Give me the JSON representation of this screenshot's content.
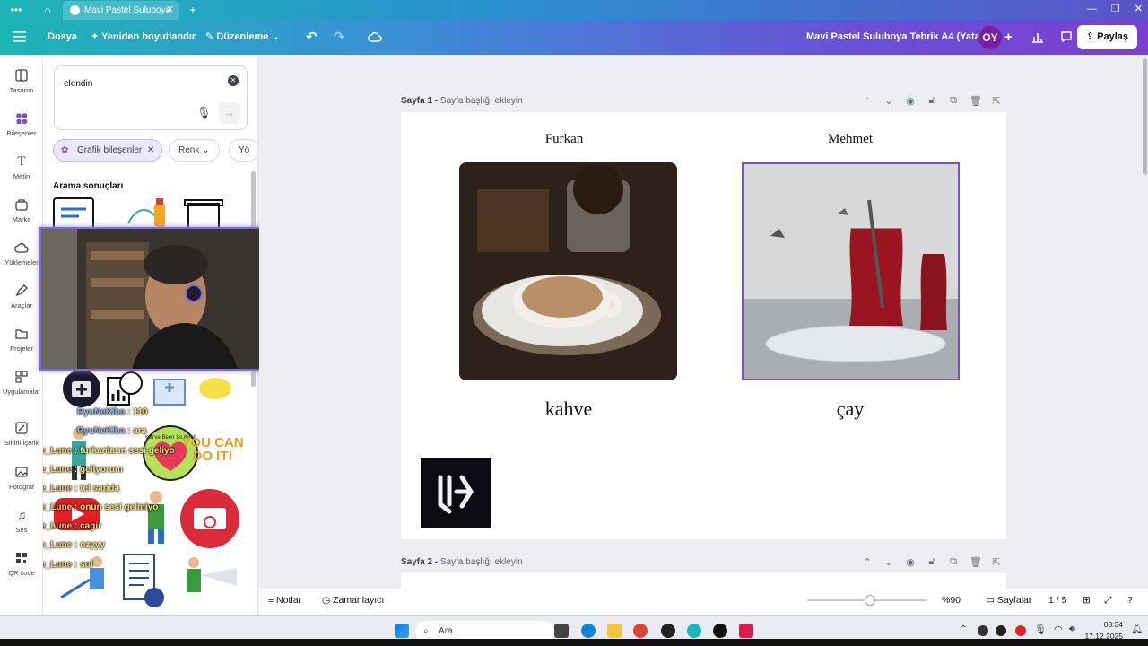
{
  "browser": {
    "tab_title": "Mavi Pastel Suluboya",
    "new_tab_symbol": "+"
  },
  "header": {
    "file": "Dosya",
    "resize": "Yeniden boyutlandır",
    "edit": "Düzenleme",
    "doc_title": "Mavi Pastel Suluboya Tebrik A4 (Yatay)",
    "avatar": "OY",
    "share": "Paylaş"
  },
  "rail": {
    "items": [
      {
        "label": "Tasarım",
        "icon": "layout-icon"
      },
      {
        "label": "Bileşenler",
        "icon": "elements-icon"
      },
      {
        "label": "Metin",
        "icon": "text-icon"
      },
      {
        "label": "Marka",
        "icon": "brand-icon"
      },
      {
        "label": "Yüklemeler",
        "icon": "upload-icon"
      },
      {
        "label": "Araçlar",
        "icon": "draw-icon"
      },
      {
        "label": "Projeler",
        "icon": "folder-icon"
      },
      {
        "label": "Uygulamalar",
        "icon": "apps-icon"
      },
      {
        "label": "Sihirli İçerik",
        "icon": "magic-icon"
      },
      {
        "label": "Fotoğraf",
        "icon": "photo-icon"
      },
      {
        "label": "Ses",
        "icon": "music-icon"
      },
      {
        "label": "QR code",
        "icon": "qr-icon"
      }
    ]
  },
  "panel": {
    "search_value": "elendin",
    "chip_active": "Grafik bileşenler",
    "chip_color": "Renk",
    "chip_more": "Yö",
    "results_title": "Arama sonuçları"
  },
  "chat": [
    {
      "user": "RyuNeKiba",
      "msg": ": 110"
    },
    {
      "user": "RyuNeKiba",
      "msg": ": ara"
    },
    {
      "user": "De_Lune",
      "msg": ": furkanların sesi geliyo"
    },
    {
      "user": "De_Lune",
      "msg": ": geliyorum"
    },
    {
      "user": "De_Lune",
      "msg": ": tel sarjda"
    },
    {
      "user": "De_Lune",
      "msg": ": onun sesi gelmiyo"
    },
    {
      "user": "De_Lune",
      "msg": ": cagir"
    },
    {
      "user": "De_Lune",
      "msg": ": ozyyy"
    },
    {
      "user": "De_Lune",
      "msg": ": sol"
    }
  ],
  "stickers": {
    "youve_been": "You've Been So Kind!",
    "you_can_do_it": "YOU CAN DO IT!"
  },
  "canvas": {
    "page1_label": "Sayfa 1 -",
    "page1_hint": "Sayfa başlığı ekleyin",
    "page2_label": "Sayfa 2 -",
    "page2_hint": "Sayfa başlığı ekleyin",
    "name_left": "Furkan",
    "name_right": "Mehmet",
    "word_left": "kahve",
    "word_right": "çay"
  },
  "footer": {
    "notes": "Notlar",
    "timer": "Zamanlayıcı",
    "zoom": "%90",
    "zoom_level": 0.52,
    "pages": "Sayfalar",
    "page_count": "1 / 5"
  },
  "taskbar": {
    "search": "Ara",
    "time": "03:34",
    "date": "17.12.2025"
  },
  "colors": {
    "header_start": "#1cb5b5",
    "header_end": "#7b3fd0",
    "selection": "#7d4cdb",
    "avatar_bg": "#7b1fa2"
  }
}
